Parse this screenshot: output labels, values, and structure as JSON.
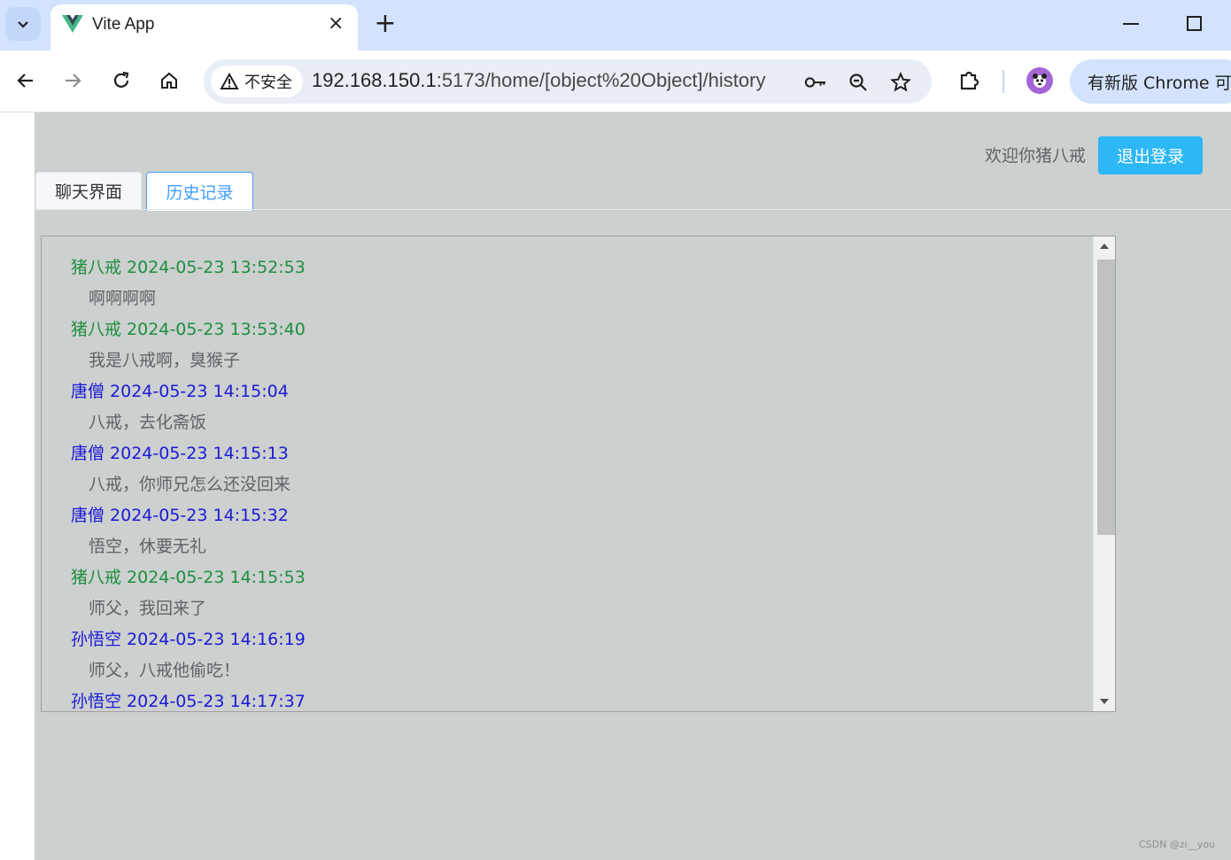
{
  "browser": {
    "tab_title": "Vite App",
    "tab_close": "×",
    "new_tab": "+",
    "security_label": "不安全",
    "url_host": "192.168.150.1",
    "url_path": ":5173/home/[object%20Object]/history",
    "update_label": "有新版 Chrome 可用"
  },
  "header": {
    "welcome": "欢迎你猪八戒",
    "logout_label": "退出登录"
  },
  "tabs": [
    {
      "label": "聊天界面",
      "active": false
    },
    {
      "label": "历史记录",
      "active": true
    }
  ],
  "colors": {
    "self": "#1e8e3e",
    "other": "#1a1ad6",
    "accent": "#2db7f5"
  },
  "messages": [
    {
      "header": "猪八戒 2024-05-23 13:52:53",
      "body": "啊啊啊啊",
      "color": "green"
    },
    {
      "header": "猪八戒 2024-05-23 13:53:40",
      "body": "我是八戒啊，臭猴子",
      "color": "green"
    },
    {
      "header": "唐僧 2024-05-23 14:15:04",
      "body": "八戒，去化斋饭",
      "color": "blue"
    },
    {
      "header": "唐僧 2024-05-23 14:15:13",
      "body": "八戒，你师兄怎么还没回来",
      "color": "blue"
    },
    {
      "header": "唐僧 2024-05-23 14:15:32",
      "body": "悟空，休要无礼",
      "color": "blue"
    },
    {
      "header": "猪八戒 2024-05-23 14:15:53",
      "body": "师父，我回来了",
      "color": "green"
    },
    {
      "header": "孙悟空 2024-05-23 14:16:19",
      "body": "师父，八戒他偷吃！",
      "color": "blue"
    },
    {
      "header": "孙悟空 2024-05-23 14:17:37",
      "body": "",
      "color": "blue"
    }
  ],
  "watermark": "CSDN @zi__you"
}
